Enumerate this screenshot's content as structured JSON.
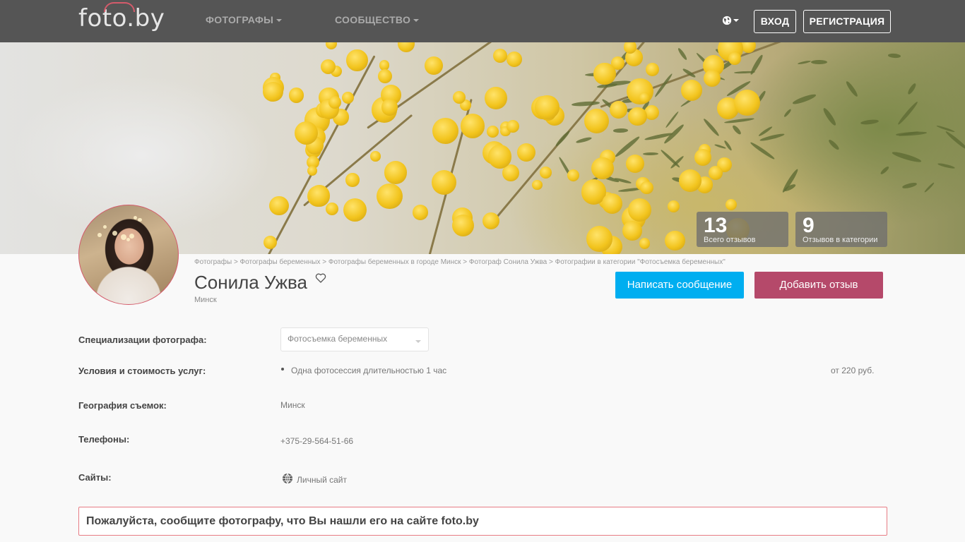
{
  "header": {
    "logo": "foto.by",
    "nav": [
      {
        "label": "ФОТОГРАФЫ"
      },
      {
        "label": "СООБЩЕСТВО"
      }
    ],
    "login": "ВХОД",
    "register": "РЕГИСТРАЦИЯ"
  },
  "stats": {
    "total_reviews": {
      "value": "13",
      "label": "Всего отзывов"
    },
    "category_reviews": {
      "value": "9",
      "label": "Отзывов в категории"
    }
  },
  "breadcrumb": "Фотографы > Фотографы беременных > Фотографы беременных в городе Минск > Фотограф Сонила Ужва > Фотографии в категории \"Фотосъемка беременных\"",
  "profile": {
    "name": "Сонила Ужва",
    "city": "Минск"
  },
  "actions": {
    "message": "Написать сообщение",
    "review": "Добавить отзыв"
  },
  "info": {
    "specializations": {
      "label": "Специализации фотографа:",
      "selected": "Фотосъемка беременных"
    },
    "conditions": {
      "label": "Условия и стоимость услуг:",
      "item": "Одна фотосессия длительностью 1 час",
      "price": "от 220 руб."
    },
    "geography": {
      "label": "География съемок:",
      "value": "Минск"
    },
    "phones": {
      "label": "Телефоны:",
      "value": "+375-29-564-51-66"
    },
    "sites": {
      "label": "Сайты:",
      "value": "Личный сайт"
    }
  },
  "notice": "Пожалуйста, сообщите фотографу, что Вы нашли его на сайте foto.by",
  "colors": {
    "header_bg": "#555555",
    "message_button": "#00aef0",
    "review_button": "#b5496a",
    "accent": "#d45b6b"
  }
}
